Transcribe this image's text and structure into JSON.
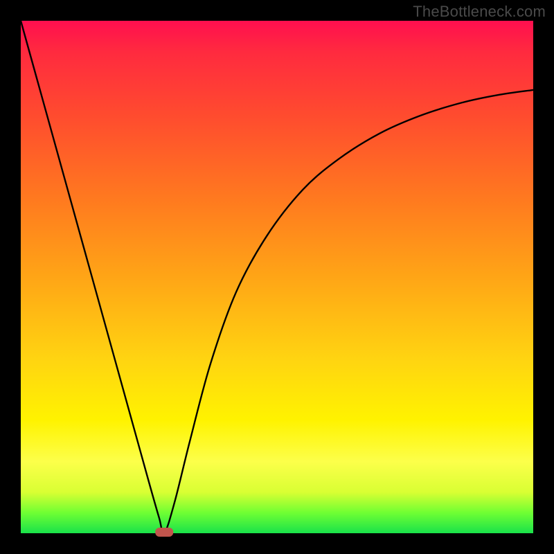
{
  "watermark": "TheBottleneck.com",
  "chart_data": {
    "type": "line",
    "title": "",
    "xlabel": "",
    "ylabel": "",
    "xlim": [
      0,
      100
    ],
    "ylim": [
      0,
      100
    ],
    "series": [
      {
        "name": "curve",
        "x": [
          0,
          5,
          10,
          15,
          20,
          25,
          27,
          28,
          30,
          33,
          37,
          42,
          48,
          55,
          62,
          70,
          78,
          86,
          93,
          100
        ],
        "y": [
          100,
          82,
          64,
          46,
          28,
          10,
          3,
          0,
          6,
          18,
          33,
          47,
          58,
          67,
          73,
          78,
          81.5,
          84,
          85.5,
          86.5
        ]
      }
    ],
    "marker": {
      "x": 28,
      "y": 0
    },
    "background_gradient": [
      "#ff0f4f",
      "#ff7a1f",
      "#fff300",
      "#19e24a"
    ]
  }
}
